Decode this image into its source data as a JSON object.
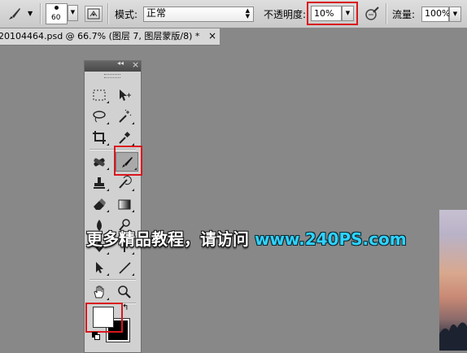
{
  "options_bar": {
    "brush_size": "60",
    "mode_label": "模式:",
    "mode_value": "正常",
    "opacity_label": "不透明度:",
    "opacity_value": "10%",
    "flow_label": "流量:",
    "flow_value": "100%",
    "highlight_color": "#d9171d"
  },
  "document_tab": {
    "title": "20104464.psd @ 66.7% (图层 7, 图层蒙版/8) *",
    "close_glyph": "×"
  },
  "tools_panel": {
    "collapse_glyph": "◂◂",
    "close_glyph": "×",
    "active_tool": "brush-tool",
    "foreground_color": "#ffffff",
    "background_color": "#000000"
  },
  "watermark": {
    "text_cn": "更多精品教程，请访问 ",
    "text_url": "www.240PS.com"
  }
}
